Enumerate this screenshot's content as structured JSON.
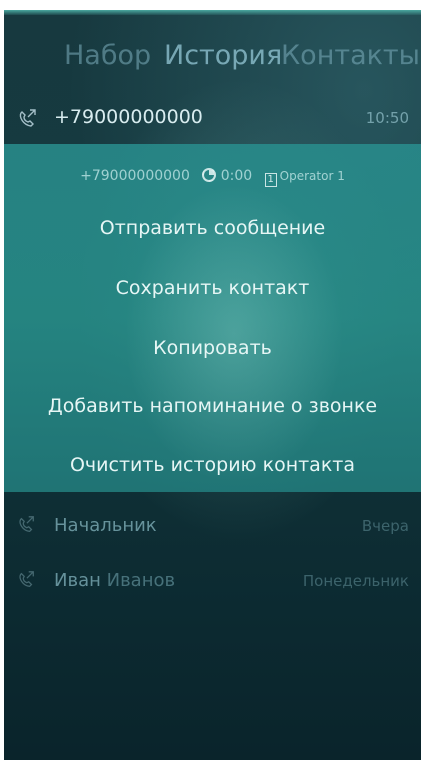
{
  "tabs": {
    "dial": "Набор",
    "history": "История",
    "contacts": "Контакты"
  },
  "selected_call": {
    "icon": "outgoing-call-icon",
    "number": "+79000000000",
    "time": "10:50"
  },
  "details": {
    "number": "+79000000000",
    "duration_icon": "clock-icon",
    "duration": "0:00",
    "sim_icon": "sim-card-icon",
    "sim_slot": "1",
    "operator": "Operator 1"
  },
  "menu": {
    "send_message": "Отправить сообщение",
    "save_contact": "Сохранить контакт",
    "copy": "Копировать",
    "add_reminder": "Добавить напоминание о звонке",
    "clear_history": "Очистить историю контакта"
  },
  "calls": [
    {
      "icon": "outgoing-call-icon",
      "first": "Начальник",
      "last": "",
      "date": "Вчера"
    },
    {
      "icon": "outgoing-call-icon",
      "first": "Иван",
      "last": "Иванов",
      "date": "Понедельник"
    }
  ],
  "colors": {
    "background": "#153a40",
    "menu": "#2a8c8a",
    "accent": "#4aa8a0"
  }
}
